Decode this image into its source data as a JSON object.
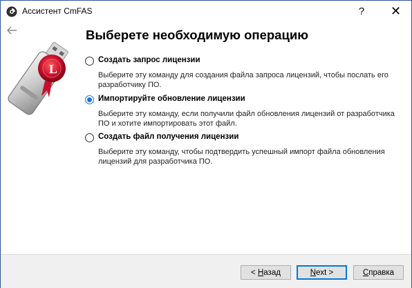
{
  "window": {
    "title": "Ассистент CmFAS",
    "help_label": "?",
    "close_label": "✕"
  },
  "heading": "Выберете необходимую операцию",
  "options": [
    {
      "label": "Создать запрос лицензии",
      "description": "Выберите эту команду для создания файла запроса лицензий, чтобы послать его разработчику ПО.",
      "selected": false
    },
    {
      "label": "Импортируйте обновление лицензии",
      "description": "Выберите эту команду, если получили файл обновления лицензий от разработчика ПО и хотите импортировать этот файл.",
      "selected": true
    },
    {
      "label": "Создать файл получения лицензии",
      "description": "Выберите эту команду, чтобы подтвердить успешный импорт файла обновления лицензий для разработчика ПО.",
      "selected": false
    }
  ],
  "footer": {
    "back_prefix": "< ",
    "back_mnemonic": "Н",
    "back_rest": "азад",
    "next_mnemonic": "N",
    "next_rest": "ext >",
    "help_mnemonic": "С",
    "help_rest": "правка"
  },
  "colors": {
    "accent": "#0078d7",
    "radio_selected": "#1a73d9",
    "footer_bg": "#f0f0f0",
    "seal_red": "#c8102e"
  }
}
